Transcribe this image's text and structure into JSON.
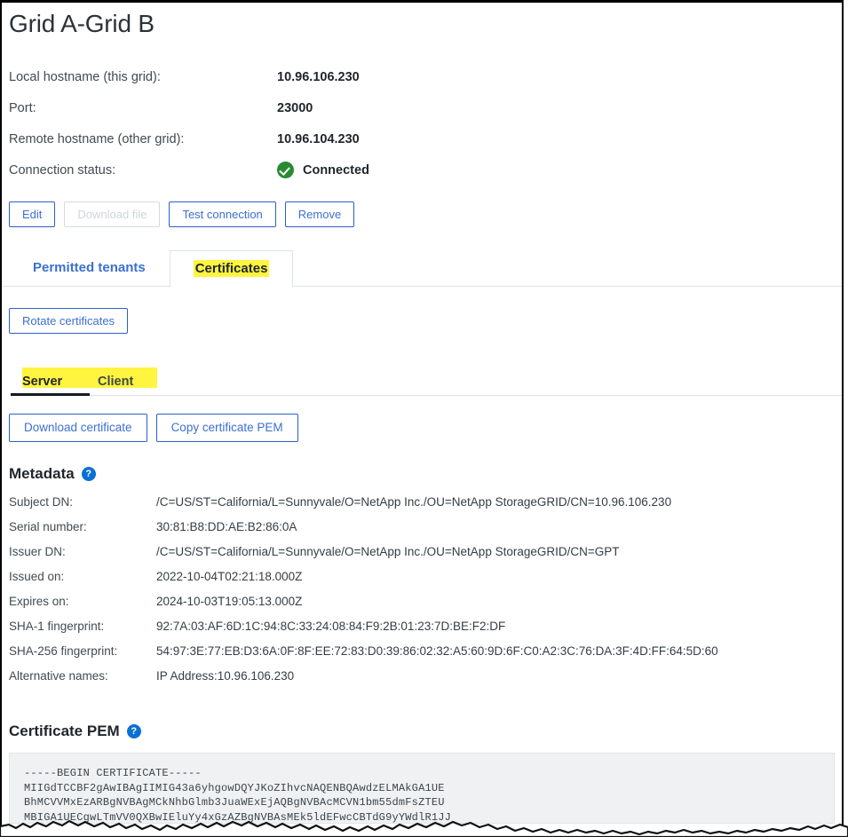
{
  "page_title": "Grid A-Grid B",
  "summary": [
    {
      "label": "Local hostname (this grid):",
      "value": "10.96.106.230",
      "icon": null
    },
    {
      "label": "Port:",
      "value": "23000",
      "icon": null
    },
    {
      "label": "Remote hostname (other grid):",
      "value": "10.96.104.230",
      "icon": null
    },
    {
      "label": "Connection status:",
      "value": "Connected",
      "icon": "check-circle-icon"
    }
  ],
  "actions": {
    "edit": "Edit",
    "download_file": "Download file",
    "test_connection": "Test connection",
    "remove": "Remove"
  },
  "tabs": [
    {
      "label": "Permitted tenants",
      "active": false
    },
    {
      "label": "Certificates",
      "active": true
    }
  ],
  "rotate_button": "Rotate certificates",
  "subtabs": [
    {
      "label": "Server",
      "active": true
    },
    {
      "label": "Client",
      "active": false
    }
  ],
  "cert_buttons": {
    "download_certificate": "Download certificate",
    "copy_certificate_pem": "Copy certificate PEM"
  },
  "metadata": {
    "heading": "Metadata",
    "help_glyph": "?",
    "rows": [
      {
        "label": "Subject DN:",
        "value": "/C=US/ST=California/L=Sunnyvale/O=NetApp Inc./OU=NetApp StorageGRID/CN=10.96.106.230"
      },
      {
        "label": "Serial number:",
        "value": "30:81:B8:DD:AE:B2:86:0A"
      },
      {
        "label": "Issuer DN:",
        "value": "/C=US/ST=California/L=Sunnyvale/O=NetApp Inc./OU=NetApp StorageGRID/CN=GPT"
      },
      {
        "label": "Issued on:",
        "value": "2022-10-04T02:21:18.000Z"
      },
      {
        "label": "Expires on:",
        "value": "2024-10-03T19:05:13.000Z"
      },
      {
        "label": "SHA-1 fingerprint:",
        "value": "92:7A:03:AF:6D:1C:94:8C:33:24:08:84:F9:2B:01:23:7D:BE:F2:DF"
      },
      {
        "label": "SHA-256 fingerprint:",
        "value": "54:97:3E:77:EB:D3:6A:0F:8F:EE:72:83:D0:39:86:02:32:A5:60:9D:6F:C0:A2:3C:76:DA:3F:4D:FF:64:5D:60"
      },
      {
        "label": "Alternative names:",
        "value": "IP Address:10.96.106.230"
      }
    ]
  },
  "certificate_pem": {
    "heading": "Certificate PEM",
    "help_glyph": "?",
    "lines": [
      "-----BEGIN CERTIFICATE-----",
      "MIIGdTCCBF2gAwIBAgIIMIG43a6yhgowDQYJKoZIhvcNAQENBQAwdzELMAkGA1UE",
      "BhMCVVMxEzARBgNVBAgMCkNhbGlmb3JuaWExEjAQBgNVBAcMCVN1bm55dmFsZTEU",
      "MBIGA1UECgwLTmVV0QXBwIEluYy4xGzAZBgNVBAsMEk5ldEFwcCBTdG9yYWdlR1JJ"
    ]
  },
  "colors": {
    "accent_blue": "#3d6fd1",
    "highlight_yellow": "#fff43f",
    "status_green": "#2a8a33",
    "help_blue": "#0a70d4"
  }
}
